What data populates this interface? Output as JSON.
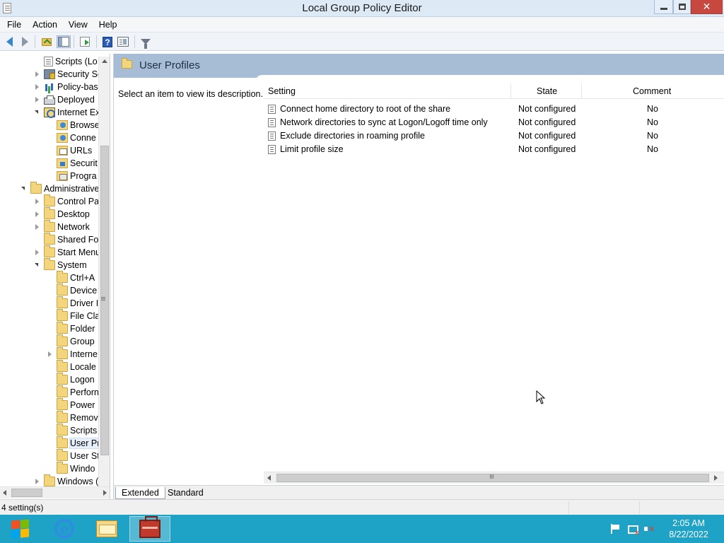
{
  "window": {
    "title": "Local Group Policy Editor",
    "close_glyph": "✕"
  },
  "menu": [
    "File",
    "Action",
    "View",
    "Help"
  ],
  "toolbar": {
    "icons": [
      "back-icon",
      "forward-icon",
      "up-one-level-icon",
      "show-hide-tree-icon",
      "export-list-icon",
      "help-icon",
      "properties-icon",
      "filter-icon"
    ],
    "help_glyph": "?"
  },
  "tree": {
    "items": [
      {
        "label": "Scripts (Lo",
        "icon": "script-icon",
        "expander": "none"
      },
      {
        "label": "Security Se",
        "icon": "security-settings-icon",
        "expander": "collapsed"
      },
      {
        "label": "Policy-bas",
        "icon": "chart-icon",
        "expander": "collapsed"
      },
      {
        "label": "Deployed",
        "icon": "printer-icon",
        "expander": "collapsed"
      },
      {
        "label": "Internet Ex",
        "icon": "internet-explorer-maintenance-icon",
        "expander": "expanded"
      },
      {
        "label": "Browse",
        "icon": "browser-user-interface-icon",
        "expander": "none"
      },
      {
        "label": "Conne",
        "icon": "connection-icon",
        "expander": "none"
      },
      {
        "label": "URLs",
        "icon": "urls-icon",
        "expander": "none"
      },
      {
        "label": "Securit",
        "icon": "security-icon",
        "expander": "none"
      },
      {
        "label": "Progra",
        "icon": "programs-icon",
        "expander": "none"
      },
      {
        "label": "Administrative",
        "icon": "folder-icon",
        "expander": "expanded"
      },
      {
        "label": "Control Pa",
        "icon": "folder-icon",
        "expander": "collapsed"
      },
      {
        "label": "Desktop",
        "icon": "folder-icon",
        "expander": "collapsed"
      },
      {
        "label": "Network",
        "icon": "folder-icon",
        "expander": "collapsed"
      },
      {
        "label": "Shared Fol",
        "icon": "folder-icon",
        "expander": "none"
      },
      {
        "label": "Start Menu",
        "icon": "folder-icon",
        "expander": "collapsed"
      },
      {
        "label": "System",
        "icon": "folder-icon",
        "expander": "expanded"
      },
      {
        "label": "Ctrl+A",
        "icon": "folder-icon",
        "expander": "none"
      },
      {
        "label": "Device",
        "icon": "folder-icon",
        "expander": "none"
      },
      {
        "label": "Driver I",
        "icon": "folder-icon",
        "expander": "none"
      },
      {
        "label": "File Cla",
        "icon": "folder-icon",
        "expander": "none"
      },
      {
        "label": "Folder",
        "icon": "folder-icon",
        "expander": "none"
      },
      {
        "label": "Group",
        "icon": "folder-icon",
        "expander": "none"
      },
      {
        "label": "Interne",
        "icon": "folder-icon",
        "expander": "collapsed"
      },
      {
        "label": "Locale",
        "icon": "folder-icon",
        "expander": "none"
      },
      {
        "label": "Logon",
        "icon": "folder-icon",
        "expander": "none"
      },
      {
        "label": "Perforn",
        "icon": "folder-icon",
        "expander": "none"
      },
      {
        "label": "Power",
        "icon": "folder-icon",
        "expander": "none"
      },
      {
        "label": "Remov",
        "icon": "folder-icon",
        "expander": "none"
      },
      {
        "label": "Scripts",
        "icon": "folder-icon",
        "expander": "none"
      },
      {
        "label": "User Pr",
        "icon": "folder-icon",
        "expander": "none",
        "selected": true
      },
      {
        "label": "User St",
        "icon": "folder-icon",
        "expander": "none"
      },
      {
        "label": "Windo",
        "icon": "folder-icon",
        "expander": "none"
      },
      {
        "label": "Windows (",
        "icon": "folder-icon",
        "expander": "collapsed"
      }
    ]
  },
  "details": {
    "header_title": "User Profiles",
    "description": "Select an item to view its description.",
    "columns": {
      "setting": "Setting",
      "state": "State",
      "comment": "Comment"
    },
    "rows": [
      {
        "setting": "Connect home directory to root of the share",
        "state": "Not configured",
        "comment": "No"
      },
      {
        "setting": "Network directories to sync at Logon/Logoff time only",
        "state": "Not configured",
        "comment": "No"
      },
      {
        "setting": "Exclude directories in roaming profile",
        "state": "Not configured",
        "comment": "No"
      },
      {
        "setting": "Limit profile size",
        "state": "Not configured",
        "comment": "No"
      }
    ],
    "tabs": {
      "extended": "Extended",
      "standard": "Standard"
    }
  },
  "statusbar": {
    "text": "4 setting(s)"
  },
  "taskbar": {
    "apps": [
      "internet-explorer-icon",
      "file-explorer-icon",
      "group-policy-editor-icon"
    ],
    "ie_glyph": "e",
    "clock_time": "2:05 AM",
    "clock_date": "8/22/2022"
  }
}
